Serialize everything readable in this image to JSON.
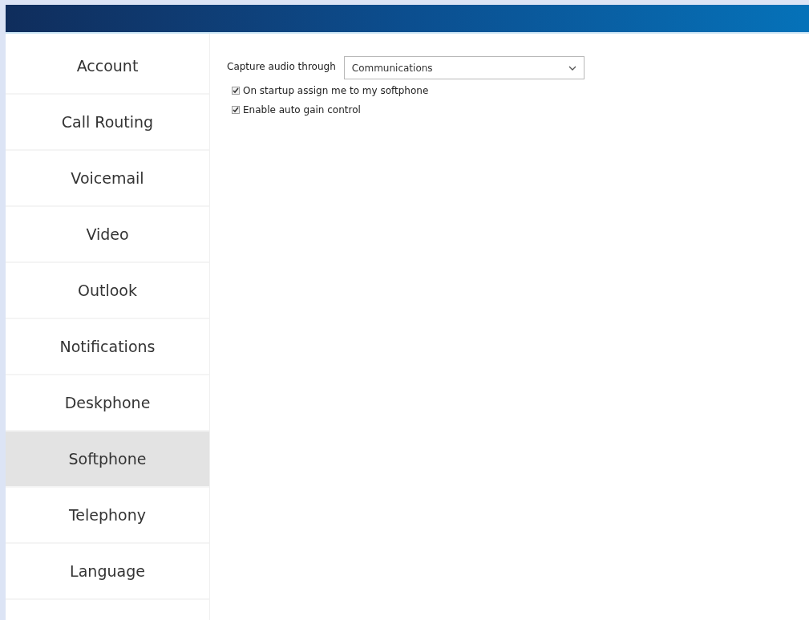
{
  "sidebar": {
    "items": [
      {
        "label": "Account",
        "selected": false
      },
      {
        "label": "Call Routing",
        "selected": false
      },
      {
        "label": "Voicemail",
        "selected": false
      },
      {
        "label": "Video",
        "selected": false
      },
      {
        "label": "Outlook",
        "selected": false
      },
      {
        "label": "Notifications",
        "selected": false
      },
      {
        "label": "Deskphone",
        "selected": false
      },
      {
        "label": "Softphone",
        "selected": true
      },
      {
        "label": "Telephony",
        "selected": false
      },
      {
        "label": "Language",
        "selected": false
      }
    ]
  },
  "settings": {
    "capture": {
      "label": "Capture audio through",
      "value": "Communications"
    },
    "options": [
      {
        "label": "On startup assign me to my softphone",
        "checked": true
      },
      {
        "label": "Enable auto gain control",
        "checked": true
      }
    ]
  }
}
